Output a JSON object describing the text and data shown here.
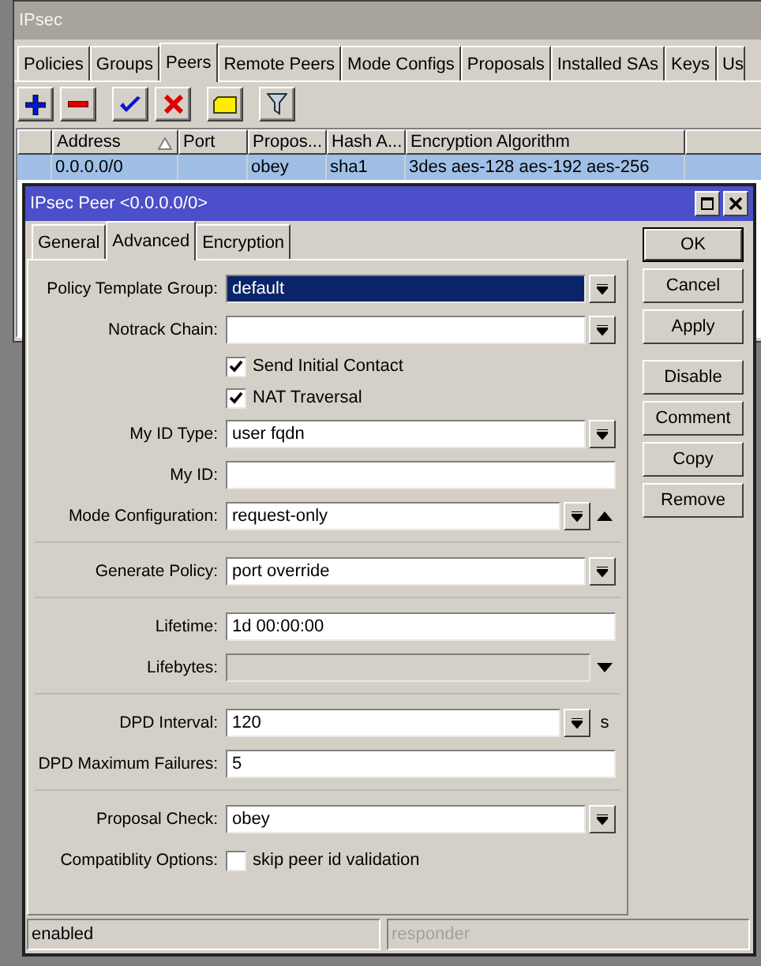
{
  "window": {
    "title": "IPsec"
  },
  "tabs": [
    {
      "label": "Policies",
      "selected": false
    },
    {
      "label": "Groups",
      "selected": false
    },
    {
      "label": "Peers",
      "selected": true
    },
    {
      "label": "Remote Peers",
      "selected": false
    },
    {
      "label": "Mode Configs",
      "selected": false
    },
    {
      "label": "Proposals",
      "selected": false
    },
    {
      "label": "Installed SAs",
      "selected": false
    },
    {
      "label": "Keys",
      "selected": false
    },
    {
      "label": "Us",
      "selected": false
    }
  ],
  "table": {
    "columns": [
      {
        "label": "Address",
        "sorted": true
      },
      {
        "label": "Port",
        "sorted": false
      },
      {
        "label": "Propos...",
        "sorted": false
      },
      {
        "label": "Hash A...",
        "sorted": false
      },
      {
        "label": "Encryption Algorithm",
        "sorted": false
      }
    ],
    "rows": [
      {
        "selected": true,
        "cells": [
          "0.0.0.0/0",
          null,
          "obey",
          "sha1",
          "3des aes-128 aes-192 aes-256"
        ]
      }
    ]
  },
  "dialog": {
    "title": "IPsec Peer <0.0.0.0/0>",
    "tabs": [
      {
        "label": "General",
        "selected": false
      },
      {
        "label": "Advanced",
        "selected": true
      },
      {
        "label": "Encryption",
        "selected": false
      }
    ],
    "groups": [
      [
        {
          "kind": "select",
          "label": "Policy Template Group:",
          "value": "default",
          "highlighted": true
        },
        {
          "kind": "select",
          "label": "Notrack Chain:"
        },
        {
          "kind": "checkbox",
          "text": "Send Initial Contact",
          "checked": true
        },
        {
          "kind": "checkbox",
          "text": "NAT Traversal",
          "checked": true
        },
        {
          "kind": "select",
          "label": "My ID Type:",
          "value": "user fqdn"
        },
        {
          "kind": "text",
          "label": "My ID:"
        },
        {
          "kind": "select",
          "label": "Mode Configuration:",
          "value": "request-only",
          "expanded": true
        }
      ],
      [
        {
          "kind": "select",
          "label": "Generate Policy:",
          "value": "port override"
        }
      ],
      [
        {
          "kind": "text",
          "label": "Lifetime:",
          "value": "1d 00:00:00"
        },
        {
          "kind": "text",
          "label": "Lifebytes:",
          "disabled": true,
          "expanded": false
        }
      ],
      [
        {
          "kind": "select",
          "label": "DPD Interval:",
          "value": "120",
          "unit": "s"
        },
        {
          "kind": "text",
          "label": "DPD Maximum Failures:",
          "value": "5"
        }
      ],
      [
        {
          "kind": "select",
          "label": "Proposal Check:",
          "value": "obey"
        },
        {
          "kind": "checkbox",
          "label": "Compatiblity Options:",
          "text": "skip peer id validation",
          "checked": false
        }
      ]
    ],
    "buttons": [
      [
        {
          "label": "OK",
          "default": true
        },
        {
          "label": "Cancel",
          "default": false
        },
        {
          "label": "Apply",
          "default": false
        }
      ],
      [
        {
          "label": "Disable",
          "default": false
        },
        {
          "label": "Comment",
          "default": false
        },
        {
          "label": "Copy",
          "default": false
        },
        {
          "label": "Remove",
          "default": false
        }
      ]
    ],
    "status": [
      {
        "text": "enabled",
        "disabled": false
      },
      {
        "text": "responder",
        "disabled": true
      }
    ]
  }
}
